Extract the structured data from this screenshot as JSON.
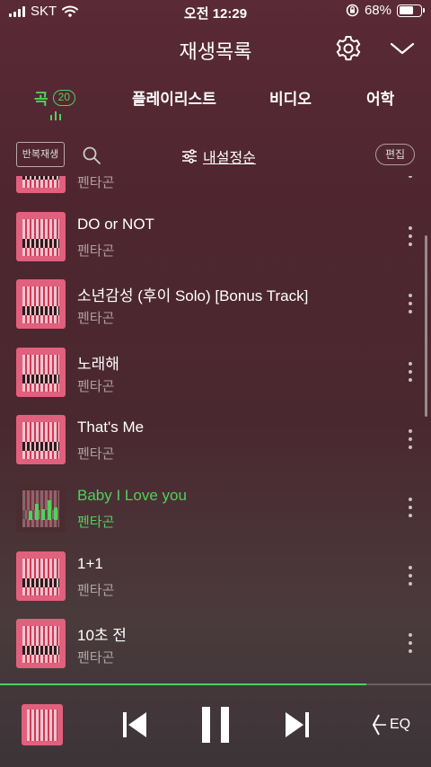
{
  "status_bar": {
    "carrier": "SKT",
    "time": "오전 12:29",
    "battery_percent": "68%",
    "battery_level": 0.68
  },
  "header": {
    "title": "재생목록"
  },
  "tabs": [
    {
      "label": "곡",
      "count": "20",
      "active": true
    },
    {
      "label": "플레이리스트"
    },
    {
      "label": "비디오"
    },
    {
      "label": "어학"
    }
  ],
  "toolbar": {
    "repeat_label": "반복재생",
    "sort_label": "내설정순",
    "edit_label": "편집"
  },
  "songs": [
    {
      "title": "",
      "artist": "펜타곤"
    },
    {
      "title": "DO or NOT",
      "artist": "펜타곤"
    },
    {
      "title": "소년감성 (후이 Solo) [Bonus Track]",
      "artist": "펜타곤"
    },
    {
      "title": "노래해",
      "artist": "펜타곤"
    },
    {
      "title": "That's Me",
      "artist": "펜타곤"
    },
    {
      "title": "Baby I Love you",
      "artist": "펜타곤",
      "playing": true
    },
    {
      "title": "1+1",
      "artist": "펜타곤"
    },
    {
      "title": "10초 전",
      "artist": "펜타곤"
    }
  ],
  "player": {
    "progress": 0.85
  },
  "colors": {
    "accent": "#4fd15a",
    "cover": "#e0607d"
  },
  "icons": {
    "settings": "gear-icon",
    "collapse": "chevron-down-icon",
    "search": "search-icon",
    "sort": "sliders-icon",
    "more": "more-vertical-icon",
    "prev": "skip-previous-icon",
    "pause": "pause-icon",
    "next": "skip-next-icon",
    "eq": "equalizer-icon"
  },
  "player_labels": {
    "eq": "EQ"
  }
}
